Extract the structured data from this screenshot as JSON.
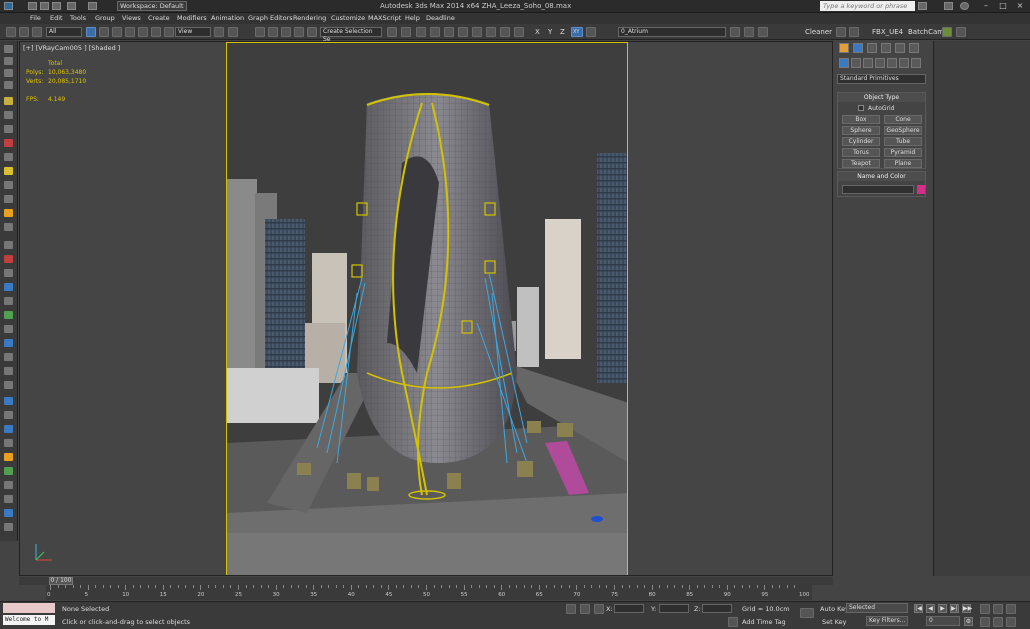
{
  "titlebar": {
    "workspace": "Workspace: Default",
    "app_title": "Autodesk 3ds Max  2014 x64     ZHA_Leeza_Soho_08.max",
    "search_placeholder": "Type a keyword or phrase"
  },
  "menu": [
    "File",
    "Edit",
    "Tools",
    "Group",
    "Views",
    "Create",
    "Modifiers",
    "Animation",
    "Graph Editors",
    "Rendering",
    "Customize",
    "MAXScript",
    "Help",
    "Deadline"
  ],
  "toolbar": {
    "filter_value": "All",
    "ref_coord_value": "View",
    "selection_set_value": "Create Selection Se",
    "axis_x": "X",
    "axis_y": "Y",
    "axis_z": "Z",
    "axis_xy": "XY",
    "layer_value": "0_Atrium",
    "cleaner_label": "Cleaner",
    "fbx_label": "FBX_UE4",
    "batchcam_label": "BatchCam"
  },
  "viewport": {
    "label": "[+] [VRayCam005 ] [Shaded ]",
    "stats": {
      "header": "Total",
      "polys_label": "Polys:",
      "polys_value": "10,063,3480",
      "verts_label": "Verts:",
      "verts_value": "20,085,1710",
      "fps_label": "FPS:",
      "fps_value": "4.149"
    }
  },
  "command_panel": {
    "category_value": "Standard Primitives",
    "object_type_title": "Object Type",
    "autogrid_label": "AutoGrid",
    "buttons": [
      "Box",
      "Cone",
      "Sphere",
      "GeoSphere",
      "Cylinder",
      "Tube",
      "Torus",
      "Pyramid",
      "Teapot",
      "Plane"
    ],
    "name_color_title": "Name and Color",
    "object_color": "#d22f8a"
  },
  "timeline": {
    "frame_display": "0 / 100",
    "ticks": [
      "0",
      "5",
      "10",
      "15",
      "20",
      "25",
      "30",
      "35",
      "40",
      "45",
      "50",
      "55",
      "60",
      "65",
      "70",
      "75",
      "80",
      "85",
      "90",
      "95",
      "100"
    ]
  },
  "statusbar": {
    "welcome": "Welcome to M",
    "selection_status": "None Selected",
    "prompt": "Click or click-and-drag to select objects",
    "x_label": "X:",
    "y_label": "Y:",
    "z_label": "Z:",
    "grid_label": "Grid = 10.0cm",
    "add_time_tag": "Add Time Tag",
    "auto_key": "Auto Key",
    "set_key": "Set Key",
    "key_mode_value": "Selected",
    "key_filters": "Key Filters...",
    "current_frame": "0"
  },
  "colors": {
    "accent_yellow": "#d4c200",
    "rig_cyan": "#3fa8e0",
    "viewport_bg": "#454545"
  }
}
